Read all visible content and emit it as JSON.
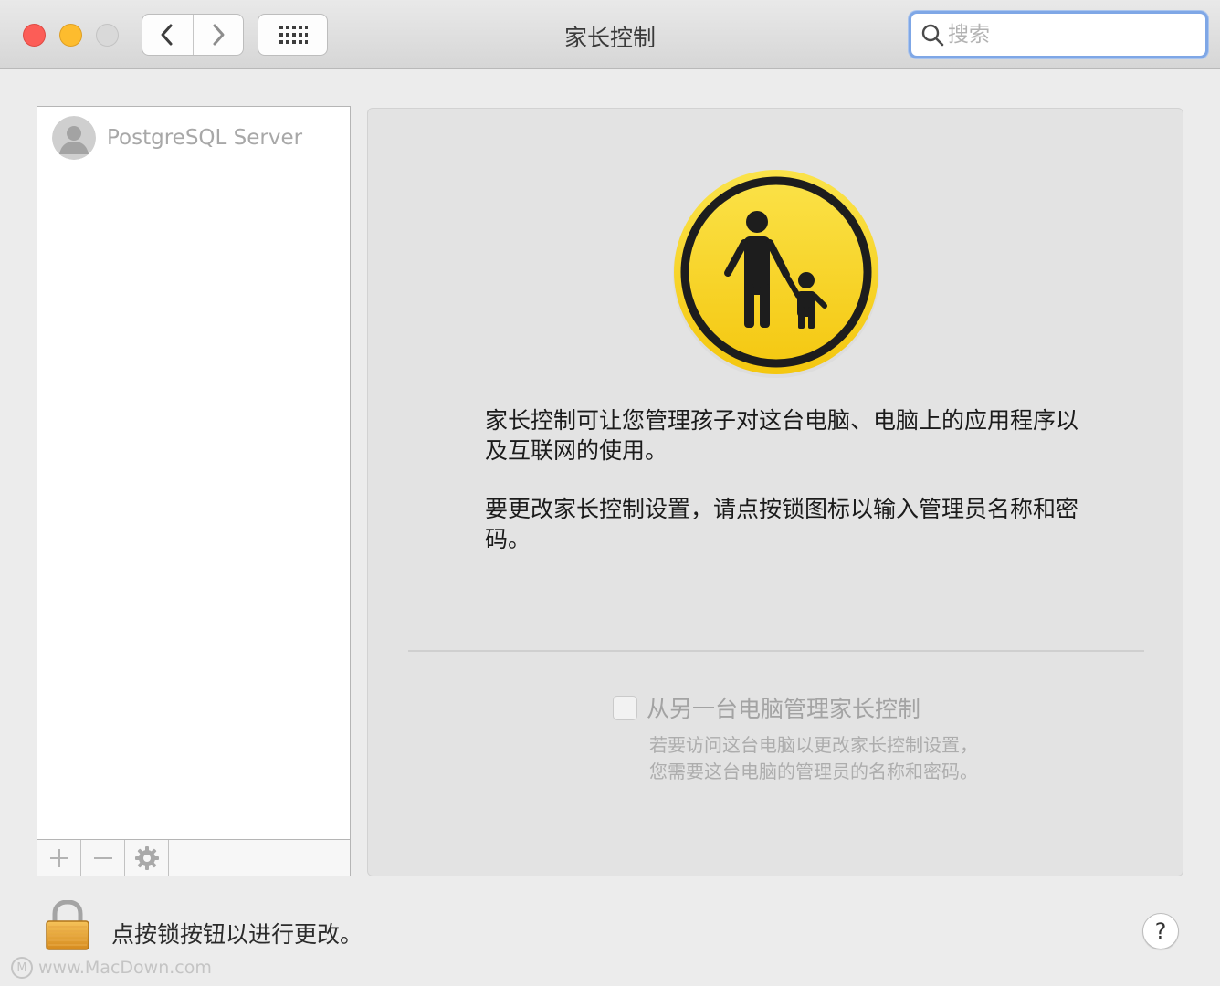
{
  "window": {
    "title": "家长控制",
    "search_placeholder": "搜索"
  },
  "users": [
    {
      "name": "PostgreSQL Server"
    }
  ],
  "panel": {
    "description_1": "家长控制可让您管理孩子对这台电脑、电脑上的应用程序以及互联网的使用。",
    "description_2": "要更改家长控制设置，请点按锁图标以输入管理员名称和密码。",
    "remote_checkbox_label": "从另一台电脑管理家长控制",
    "remote_hint_line1": "若要访问这台电脑以更改家长控制设置，",
    "remote_hint_line2": "您需要这台电脑的管理员的名称和密码。"
  },
  "footer": {
    "lock_text": "点按锁按钮以进行更改。",
    "help_label": "?"
  },
  "watermark": {
    "logo_glyph": "M",
    "text": "www.MacDown.com"
  },
  "icons": {
    "nav_back": "chevron-left-icon",
    "nav_forward": "chevron-right-icon",
    "show_all": "grid-icon",
    "search": "search-icon",
    "user": "user-avatar-icon",
    "add": "plus-icon",
    "remove": "minus-icon",
    "actions": "gear-icon",
    "parental": "parental-controls-icon",
    "lock": "lock-icon"
  },
  "colors": {
    "close": "#fc5d57",
    "minimize": "#fdbc2e",
    "zoom_disabled": "#d9d9d9",
    "search_focus": "#7fa7e6",
    "parental_yellow": "#f7d21b"
  }
}
